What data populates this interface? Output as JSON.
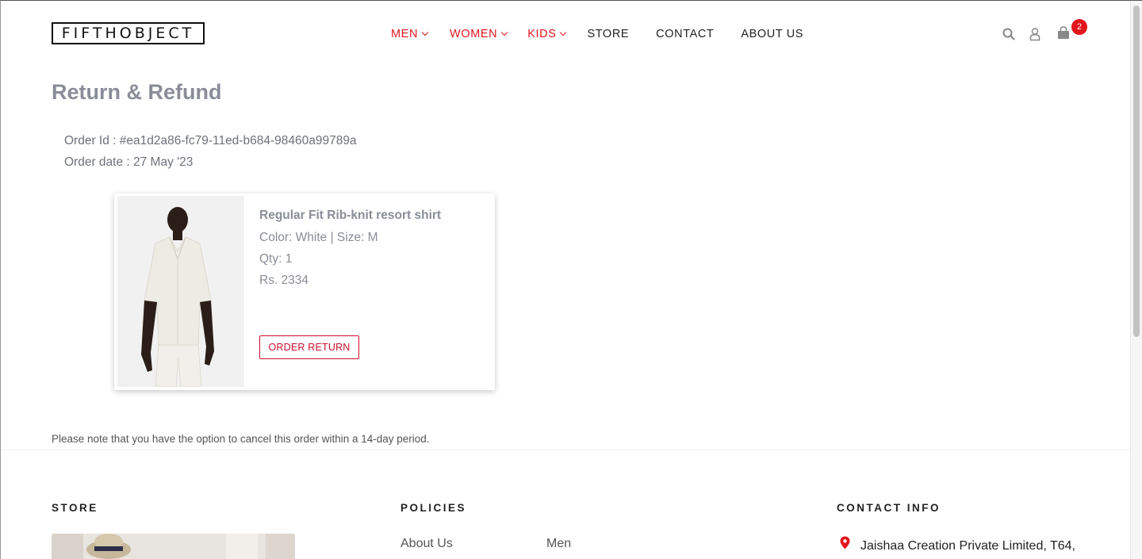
{
  "header": {
    "logo": "FIFTHOBJECT",
    "nav": [
      {
        "label": "MEN",
        "color": "#e3161b"
      },
      {
        "label": "WOMEN",
        "color": "#e3161b"
      },
      {
        "label": "KIDS",
        "color": "#e3161b"
      },
      {
        "label": "STORE"
      },
      {
        "label": "CONTACT"
      },
      {
        "label": "ABOUT US"
      }
    ],
    "icons": [
      "search-icon",
      "user-icon",
      "shopping-bag-icon"
    ],
    "cart_count": "2"
  },
  "main": {
    "title": "Return & Refund",
    "order_id": "Order Id : #ea1d2a86-fc79-11ed-b684-98460a99789a",
    "order_date": "Order date : 27 May '23",
    "item": {
      "name": "Regular Fit Rib-knit resort shirt",
      "attributes": "Color: White |  Size: M",
      "qty": "Qty: 1",
      "price": "Rs. 2334",
      "return_label": "ORDER RETURN"
    },
    "notice": "Please note that you have the option to cancel this order within a 14-day period."
  },
  "footer": {
    "store_heading": "STORE",
    "policies_heading": "POLICIES",
    "contact_heading": "CONTACT INFO",
    "policy_links": [
      "About Us",
      "Men"
    ],
    "contact_address": "Jaishaa Creation Private Limited, T64,"
  },
  "colors": {
    "accent_red": "#e3161b",
    "button_red": "#c8102e",
    "muted_text": "#8a8d98"
  }
}
